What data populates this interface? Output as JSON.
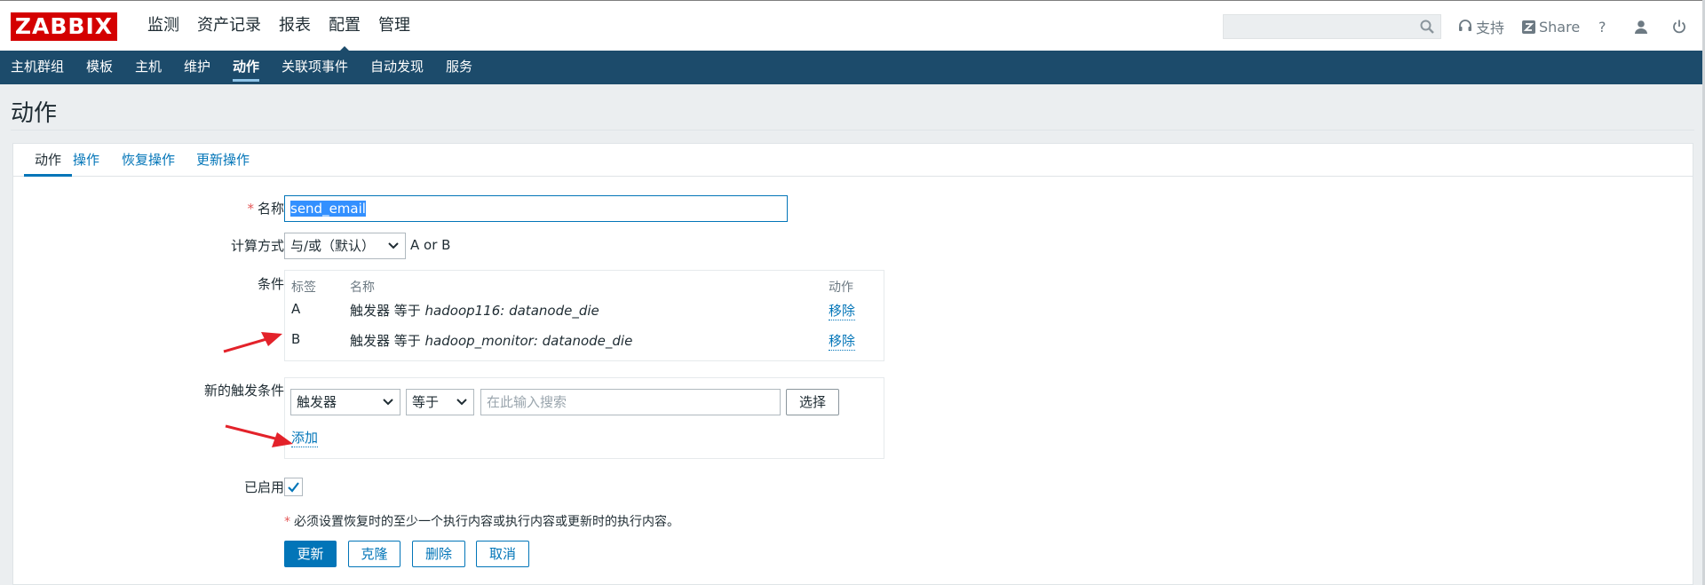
{
  "logo": "ZABBIX",
  "top_menu": [
    "监测",
    "资产记录",
    "报表",
    "配置",
    "管理"
  ],
  "top_active": "配置",
  "search": {
    "placeholder": ""
  },
  "top_right": {
    "support": "支持",
    "share": "Share",
    "help": "?"
  },
  "sub_nav": [
    "主机群组",
    "模板",
    "主机",
    "维护",
    "动作",
    "关联项事件",
    "自动发现",
    "服务"
  ],
  "sub_active": "动作",
  "page_title": "动作",
  "tabs": [
    "动作",
    "操作",
    "恢复操作",
    "更新操作"
  ],
  "form": {
    "name_label": "名称",
    "name_value": "send_email",
    "calc_label": "计算方式",
    "calc_value": "与/或（默认）",
    "calc_expr": "A or B",
    "conditions_label": "条件",
    "conditions_headers": {
      "tag": "标签",
      "name": "名称",
      "action": "动作"
    },
    "conditions": [
      {
        "tag": "A",
        "prefix": "触发器 等于 ",
        "target": "hadoop116: datanode_die",
        "action": "移除"
      },
      {
        "tag": "B",
        "prefix": "触发器 等于 ",
        "target": "hadoop_monitor: datanode_die",
        "action": "移除"
      }
    ],
    "new_condition_label": "新的触发条件",
    "new_condition_type": "触发器",
    "new_condition_operator": "等于",
    "new_condition_search_placeholder": "在此输入搜索",
    "select_button": "选择",
    "add_link": "添加",
    "enabled_label": "已启用",
    "enabled": true,
    "requirement_note": "必须设置恢复时的至少一个执行内容或执行内容或更新时的执行内容。"
  },
  "buttons": {
    "update": "更新",
    "clone": "克隆",
    "delete": "删除",
    "cancel": "取消"
  },
  "colors": {
    "brand_red": "#d40000",
    "nav_blue": "#1c4b6b",
    "accent": "#0275b8",
    "arrow": "#e3222a"
  }
}
